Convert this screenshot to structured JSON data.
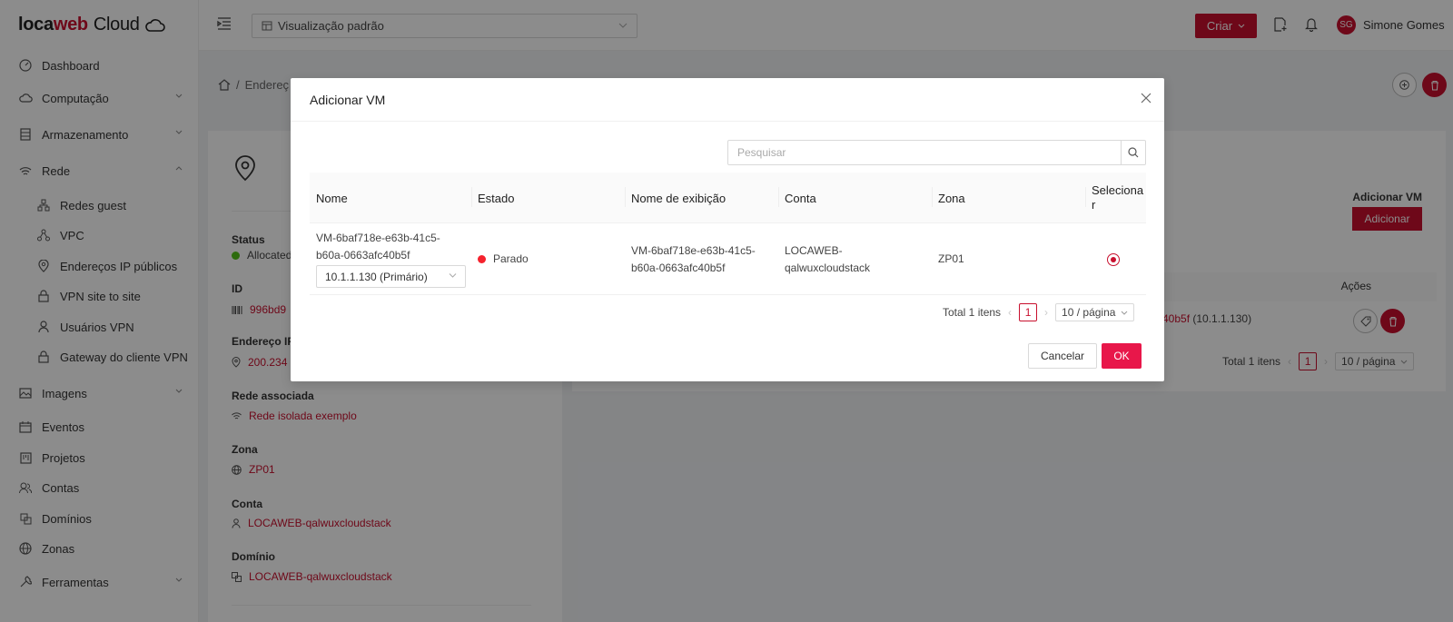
{
  "app": {
    "logo_pre": "loca",
    "logo_accent": "web",
    "logo_post": " Cloud",
    "accent_color": "#c8102e"
  },
  "sidebar": {
    "items": [
      {
        "label": "Dashboard",
        "icon": "dashboard-icon"
      },
      {
        "label": "Computação",
        "icon": "cloud-icon"
      },
      {
        "label": "Armazenamento",
        "icon": "storage-icon"
      },
      {
        "label": "Rede",
        "icon": "wifi-icon"
      },
      {
        "label": "Redes guest",
        "icon": "network-icon"
      },
      {
        "label": "VPC",
        "icon": "vpc-icon"
      },
      {
        "label": "Endereços IP públicos",
        "icon": "location-icon"
      },
      {
        "label": "VPN site to site",
        "icon": "lock-icon"
      },
      {
        "label": "Usuários VPN",
        "icon": "user-icon"
      },
      {
        "label": "Gateway do cliente VPN",
        "icon": "lock-icon"
      },
      {
        "label": "Imagens",
        "icon": "image-icon"
      },
      {
        "label": "Eventos",
        "icon": "calendar-icon"
      },
      {
        "label": "Projetos",
        "icon": "project-icon"
      },
      {
        "label": "Contas",
        "icon": "team-icon"
      },
      {
        "label": "Domínios",
        "icon": "domain-icon"
      },
      {
        "label": "Zonas",
        "icon": "globe-icon"
      },
      {
        "label": "Ferramentas",
        "icon": "tool-icon"
      }
    ]
  },
  "header": {
    "view_select": "Visualização padrão",
    "create_label": "Criar",
    "user_initials": "SG",
    "user_name": "Simone Gomes"
  },
  "background": {
    "breadcrumb": "Endereç",
    "status_label": "Status",
    "status_value": "Allocated",
    "id_label": "ID",
    "id_value": "996bd9",
    "ip_label": "Endereço IP",
    "ip_value": "200.234",
    "network_label": "Rede associada",
    "network_value": "Rede isolada exemplo",
    "zone_label": "Zona",
    "zone_value": "ZP01",
    "account_label": "Conta",
    "account_value": "LOCAWEB-qalwuxcloudstack",
    "domain_label": "Domínio",
    "domain_value": "LOCAWEB-qalwuxcloudstack",
    "add_vm_title": "Adicionar VM",
    "add_vm_button": "Adicionar",
    "actions_header": "Ações",
    "row_vm": "40b5f",
    "row_ip": " (10.1.1.130)",
    "total": "Total 1 itens",
    "page": "1",
    "page_size": "10 / página"
  },
  "modal": {
    "title": "Adicionar VM",
    "search_placeholder": "Pesquisar",
    "columns": [
      "Nome",
      "Estado",
      "Nome de exibição",
      "Conta",
      "Zona",
      "Seleciona",
      "r"
    ],
    "rows": [
      {
        "name_line1": "VM-6baf718e-e63b-41c5-",
        "name_line2": "b60a-0663afc40b5f",
        "ip_select": "10.1.1.130 (Primário)",
        "state": "Parado",
        "display_line1": "VM-6baf718e-e63b-41c5-",
        "display_line2": "b60a-0663afc40b5f",
        "account_line1": "LOCAWEB-",
        "account_line2": "qalwuxcloudstack",
        "zone": "ZP01",
        "selected": true
      }
    ],
    "total": "Total 1 itens",
    "page": "1",
    "page_size": "10 / página",
    "cancel_label": "Cancelar",
    "ok_label": "OK"
  }
}
